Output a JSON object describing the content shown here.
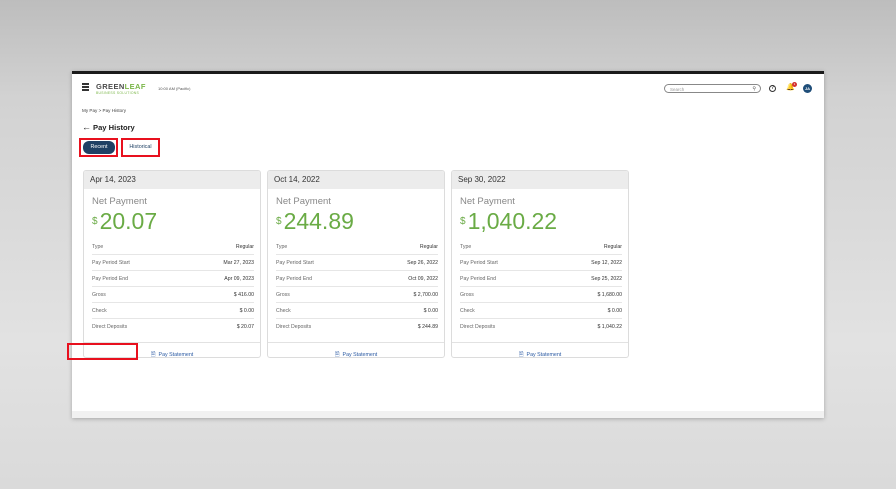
{
  "header": {
    "logo_top_a": "GREEN",
    "logo_top_b": "LEAF",
    "logo_sub": "BUSINESS SOLUTIONS",
    "time": "10:00 AM (Pacific)",
    "search_placeholder": "Search",
    "notification_count": "1",
    "avatar_initials": "JA"
  },
  "breadcrumb": "My Pay  >  Pay History",
  "page_title": "Pay History",
  "tabs": {
    "recent": "Recent",
    "historical": "Historical"
  },
  "net_label": "Net Payment",
  "currency": "$",
  "row_labels": [
    "Type",
    "Pay Period Start",
    "Pay Period End",
    "Gross",
    "Check",
    "Direct Deposits"
  ],
  "pay_statement_label": "Pay Statement",
  "cards": [
    {
      "date": "Apr 14, 2023",
      "net": "20.07",
      "type": "Regular",
      "start": "Mar 27, 2023",
      "end": "Apr 09, 2023",
      "gross": "$ 416.00",
      "check": "$ 0.00",
      "direct": "$ 20.07"
    },
    {
      "date": "Oct 14, 2022",
      "net": "244.89",
      "type": "Regular",
      "start": "Sep 26, 2022",
      "end": "Oct 09, 2022",
      "gross": "$ 2,700.00",
      "check": "$ 0.00",
      "direct": "$ 244.89"
    },
    {
      "date": "Sep 30, 2022",
      "net": "1,040.22",
      "type": "Regular",
      "start": "Sep 12, 2022",
      "end": "Sep 25, 2022",
      "gross": "$ 1,680.00",
      "check": "$ 0.00",
      "direct": "$ 1,040.22"
    }
  ],
  "colors": {
    "accent_green": "#6aab45",
    "tab_navy": "#1f4064",
    "highlight_red": "#e8101e",
    "link_blue": "#2b5aa3"
  },
  "icons": [
    "menu-icon",
    "search-icon",
    "help-icon",
    "bell-icon",
    "back-arrow-icon",
    "document-icon"
  ]
}
